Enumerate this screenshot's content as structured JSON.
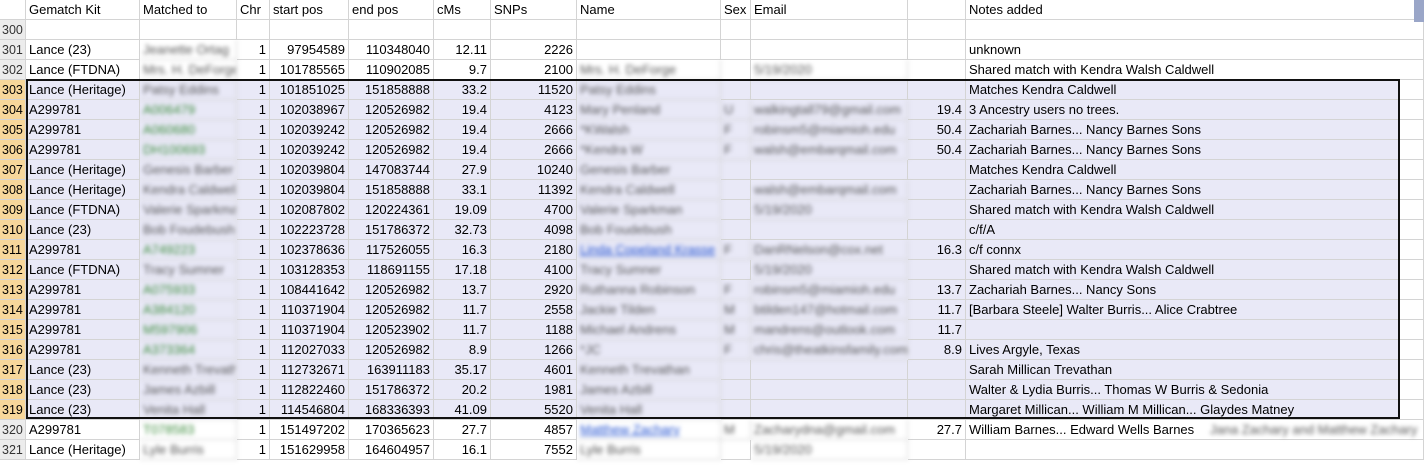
{
  "headers": [
    "Gematch Kit",
    "Matched to",
    "Chr",
    "start pos",
    "end pos",
    "cMs",
    "SNPs",
    "Name",
    "Sex",
    "Email",
    "",
    "Notes added"
  ],
  "rows": [
    {
      "n": "300",
      "cells": [
        "",
        "",
        "",
        "",
        "",
        "",
        "",
        "",
        "",
        "",
        "",
        ""
      ]
    },
    {
      "n": "301",
      "cells": [
        "Lance (23)",
        "Jeanette Ortag",
        "1",
        "97954589",
        "110348040",
        "12.11",
        "2226",
        "",
        "",
        "",
        "",
        "unknown"
      ]
    },
    {
      "n": "302",
      "cells": [
        "Lance (FTDNA)",
        "Mrs. H. DeForge",
        "1",
        "101785565",
        "110902085",
        "9.7",
        "2100",
        "Mrs. H. DeForge",
        "",
        "5/19/2020",
        "",
        "Shared match with Kendra Walsh Caldwell"
      ]
    },
    {
      "n": "303",
      "cells": [
        "Lance (Heritage)",
        "Patsy Eddins",
        "1",
        "101851025",
        "151858888",
        "33.2",
        "11520",
        "Patsy Eddins",
        "",
        "",
        "",
        "Matches Kendra Caldwell"
      ]
    },
    {
      "n": "304",
      "cells": [
        "A299781",
        "A006479",
        "1",
        "102038967",
        "120526982",
        "19.4",
        "4123",
        "Mary Penland",
        "U",
        "walkingtall79@gmail.com",
        "19.4",
        "3 Ancestry users no trees."
      ]
    },
    {
      "n": "305",
      "cells": [
        "A299781",
        "A060680",
        "1",
        "102039242",
        "120526982",
        "19.4",
        "2666",
        "*KWalsh",
        "F",
        "robinsm5@miamioh.edu",
        "50.4",
        "Zachariah Barnes... Nancy Barnes Sons"
      ]
    },
    {
      "n": "306",
      "cells": [
        "A299781",
        "DH100693",
        "1",
        "102039242",
        "120526982",
        "19.4",
        "2666",
        "*Kendra W",
        "F",
        "walsh@embarqmail.com",
        "50.4",
        "Zachariah Barnes... Nancy Barnes Sons"
      ]
    },
    {
      "n": "307",
      "cells": [
        "Lance (Heritage)",
        "Genesis Barber",
        "1",
        "102039804",
        "147083744",
        "27.9",
        "10240",
        "Genesis Barber",
        "",
        "",
        "",
        "Matches Kendra Caldwell"
      ]
    },
    {
      "n": "308",
      "cells": [
        "Lance (Heritage)",
        "Kendra Caldwell",
        "1",
        "102039804",
        "151858888",
        "33.1",
        "11392",
        "Kendra Caldwell",
        "",
        "walsh@embarqmail.com",
        "",
        "Zachariah Barnes... Nancy Barnes Sons"
      ]
    },
    {
      "n": "309",
      "cells": [
        "Lance (FTDNA)",
        "Valerie Sparkman",
        "1",
        "102087802",
        "120224361",
        "19.09",
        "4700",
        "Valerie Sparkman",
        "",
        "5/19/2020",
        "",
        "Shared match with Kendra Walsh Caldwell"
      ]
    },
    {
      "n": "310",
      "cells": [
        "Lance (23)",
        "Bob Foudebush",
        "1",
        "102223728",
        "151786372",
        "32.73",
        "4098",
        "Bob Foudebush",
        "",
        "",
        "",
        "c/f/A"
      ]
    },
    {
      "n": "311",
      "cells": [
        "A299781",
        "A749223",
        "1",
        "102378636",
        "117526055",
        "16.3",
        "2180",
        "Linda Copeland Krasse",
        "F",
        "DanRNelson@cox.net",
        "16.3",
        "c/f connx"
      ]
    },
    {
      "n": "312",
      "cells": [
        "Lance (FTDNA)",
        "Tracy Sumner",
        "1",
        "103128353",
        "118691155",
        "17.18",
        "4100",
        "Tracy Sumner",
        "",
        "5/19/2020",
        "",
        "Shared match with Kendra Walsh Caldwell"
      ]
    },
    {
      "n": "313",
      "cells": [
        "A299781",
        "A075933",
        "1",
        "108441642",
        "120526982",
        "13.7",
        "2920",
        "Ruthanna Robinson",
        "F",
        "robinsm5@miamioh.edu",
        "13.7",
        "Zachariah Barnes... Nancy Sons"
      ]
    },
    {
      "n": "314",
      "cells": [
        "A299781",
        "A384120",
        "1",
        "110371904",
        "120526982",
        "11.7",
        "2558",
        "Jackie Tilden",
        "M",
        "btilden147@hotmail.com",
        "11.7",
        "[Barbara Steele] Walter Burris... Alice Crabtree"
      ]
    },
    {
      "n": "315",
      "cells": [
        "A299781",
        "M597906",
        "1",
        "110371904",
        "120523902",
        "11.7",
        "1188",
        "Michael Andrens",
        "M",
        "mandrens@outlook.com",
        "11.7",
        ""
      ]
    },
    {
      "n": "316",
      "cells": [
        "A299781",
        "A373364",
        "1",
        "112027033",
        "120526982",
        "8.9",
        "1266",
        "*JC",
        "F",
        "chris@theatkinsfamily.com",
        "8.9",
        "Lives Argyle, Texas"
      ]
    },
    {
      "n": "317",
      "cells": [
        "Lance (23)",
        "Kenneth Trevathan",
        "1",
        "112732671",
        "163911183",
        "35.17",
        "4601",
        "Kenneth Trevathan",
        "",
        "",
        "",
        "Sarah Millican Trevathan"
      ]
    },
    {
      "n": "318",
      "cells": [
        "Lance (23)",
        "James Azbill",
        "1",
        "112822460",
        "151786372",
        "20.2",
        "1981",
        "James Azbill",
        "",
        "",
        "",
        "Walter & Lydia Burris... Thomas W Burris & Sedonia"
      ]
    },
    {
      "n": "319",
      "cells": [
        "Lance (23)",
        "Venita Hall",
        "1",
        "114546804",
        "168336393",
        "41.09",
        "5520",
        "Venita Hall",
        "",
        "",
        "",
        "Margaret Millican... William M Millican... Glaydes Matney"
      ]
    },
    {
      "n": "320",
      "cells": [
        "A299781",
        "T078583",
        "1",
        "151497202",
        "170365623",
        "27.7",
        "4857",
        "Matthew Zachary",
        "M",
        "Zacharydna@gmail.com",
        "27.7",
        "William Barnes... Edward Wells Barnes"
      ]
    },
    {
      "n": "321",
      "cells": [
        "Lance (Heritage)",
        "Lyle Burris",
        "1",
        "151629958",
        "164604957",
        "16.1",
        "7552",
        "Lyle Burris",
        "",
        "5/19/2020",
        "",
        ""
      ]
    }
  ],
  "overflow_note_320": "Jana Zachary and Matthew Zachary",
  "selected_rows": [
    "303",
    "304",
    "305",
    "306",
    "307",
    "308",
    "309",
    "310",
    "311",
    "312",
    "313",
    "314",
    "315",
    "316",
    "317",
    "318",
    "319"
  ]
}
